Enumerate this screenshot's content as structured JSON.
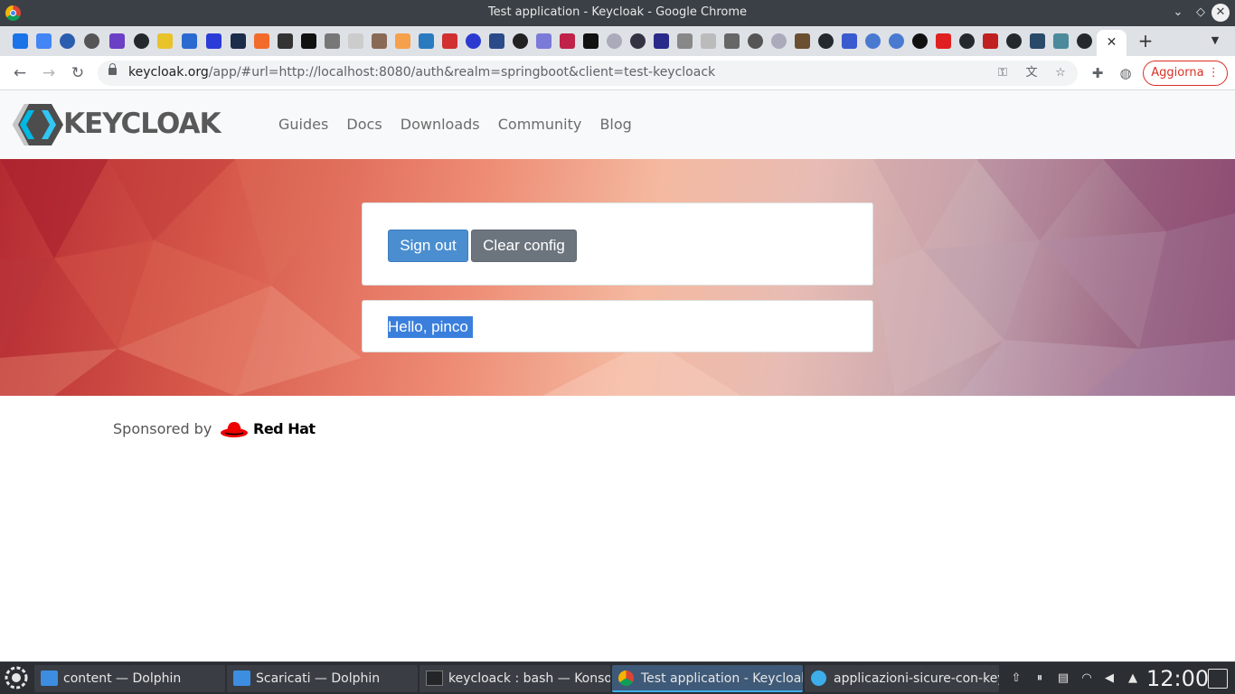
{
  "window": {
    "title": "Test application - Keycloak - Google Chrome"
  },
  "browser": {
    "url_host": "keycloak.org",
    "url_path": "/app/#url=http://localhost:8080/auth&realm=springboot&client=test-keycloack",
    "update_label": "Aggiorna",
    "active_tab_close": "✕",
    "new_tab": "+"
  },
  "site": {
    "logo_text": "KEYCLOAK",
    "nav": [
      "Guides",
      "Docs",
      "Downloads",
      "Community",
      "Blog"
    ]
  },
  "app": {
    "sign_out_label": "Sign out",
    "clear_config_label": "Clear config",
    "greeting": "Hello, pinco"
  },
  "footer": {
    "sponsored_by": "Sponsored by",
    "sponsor_name": "Red Hat"
  },
  "taskbar": {
    "tasks": [
      "content — Dolphin",
      "Scaricati — Dolphin",
      "keycloack : bash — Konsole",
      "Test application - Keycloak ...",
      "applicazioni-sicure-con-key..."
    ],
    "clock": "12:00"
  },
  "colors": {
    "primary_button": "#4a8ed0",
    "secondary_button": "#6c757d",
    "selection": "#3b7fdc",
    "update_red": "#d93025"
  }
}
